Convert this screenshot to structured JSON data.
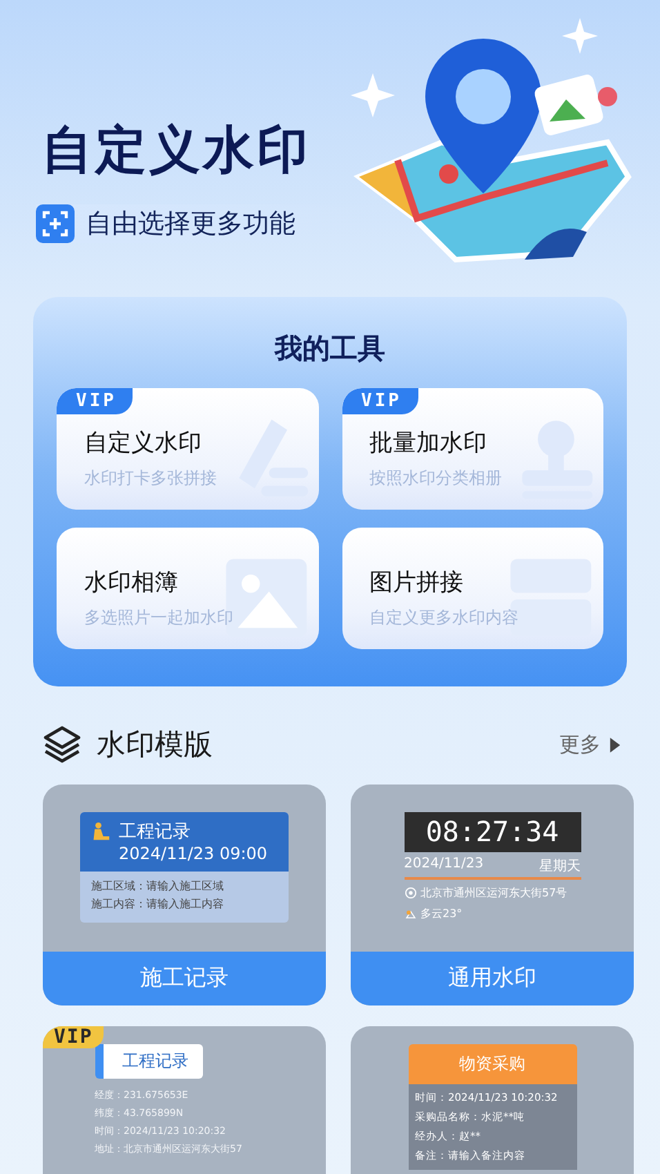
{
  "hero": {
    "title": "自定义水印",
    "subtitle": "自由选择更多功能"
  },
  "tools": {
    "title": "我的工具",
    "items": [
      {
        "kind": "edit",
        "badge": "VIP",
        "title": "自定义水印",
        "desc": "水印打卡多张拼接"
      },
      {
        "kind": "stamp",
        "badge": "VIP",
        "title": "批量加水印",
        "desc": "按照水印分类相册"
      },
      {
        "kind": "album",
        "title": "水印相簿",
        "desc": "多选照片一起加水印"
      },
      {
        "kind": "collage",
        "title": "图片拼接",
        "desc": "自定义更多水印内容"
      }
    ]
  },
  "templates_section": {
    "title": "水印模版",
    "more": "更多"
  },
  "templates": [
    {
      "kind": "engineering",
      "title": "工程记录",
      "datetime": "2024/11/23   09:00",
      "lines": [
        "施工区域：请输入施工区域",
        "施工内容：请输入施工内容"
      ],
      "label": "施工记录"
    },
    {
      "kind": "clock",
      "time": "08:27:34",
      "date": "2024/11/23",
      "weekday": "星期天",
      "address": "北京市通州区运河东大街57号",
      "weather": "多云23°",
      "label": "通用水印"
    },
    {
      "kind": "tagged",
      "badge": "VIP",
      "title": "工程记录",
      "lines": [
        "经度：231.675653E",
        "纬度：43.765899N",
        "时间：2024/11/23   10:20:32",
        "地址：北京市通州区运河东大街57"
      ]
    },
    {
      "kind": "purchase",
      "title": "物资采购",
      "lines": [
        "时间：2024/11/23   10:20:32",
        "采购品名称：水泥**吨",
        "经办人：赵**",
        "备注：请输入备注内容"
      ]
    }
  ]
}
